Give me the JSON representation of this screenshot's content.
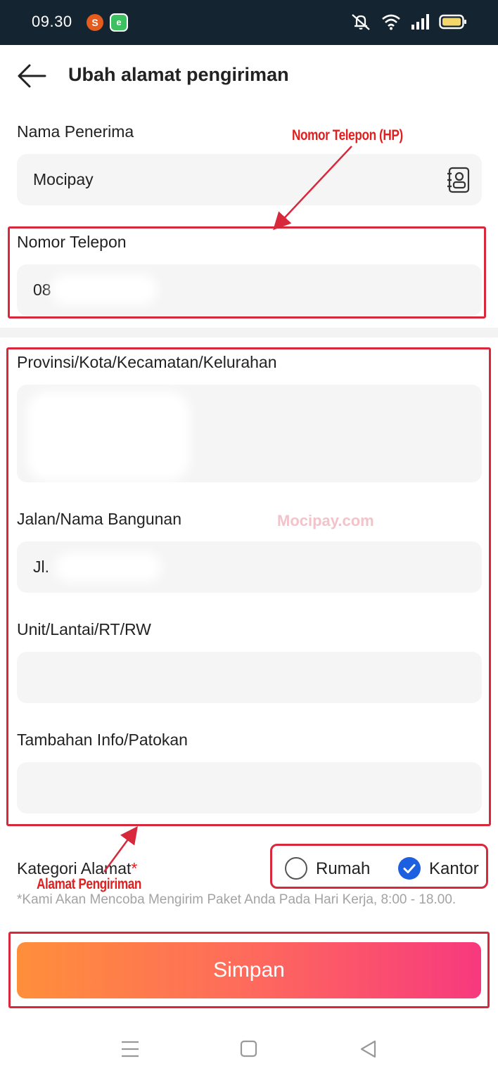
{
  "status_bar": {
    "time": "09.30",
    "app_icon_1": "S",
    "app_icon_2": "e"
  },
  "header": {
    "title": "Ubah alamat pengiriman"
  },
  "form": {
    "nama_label": "Nama Penerima",
    "nama_value": "Mocipay",
    "phone_label": "Nomor Telepon",
    "phone_value": "08",
    "region_label": "Provinsi/Kota/Kecamatan/Kelurahan",
    "region_value": "",
    "street_label": "Jalan/Nama Bangunan",
    "street_value": "Jl. ",
    "unit_label": "Unit/Lantai/RT/RW",
    "unit_value": "",
    "extra_label": "Tambahan Info/Patokan",
    "extra_value": ""
  },
  "category": {
    "label": "Kategori Alamat",
    "required_mark": "*",
    "options": [
      {
        "label": "Rumah",
        "selected": false
      },
      {
        "label": "Kantor",
        "selected": true
      }
    ],
    "note": "*Kami Akan Mencoba Mengirim Paket Anda Pada Hari Kerja, 8:00 - 18.00."
  },
  "save_button": "Simpan",
  "annotations": {
    "phone_note": "Nomor Telepon (HP)",
    "address_note": "Alamat Pengiriman",
    "watermark": "Mocipay.com",
    "color": "#d8283c"
  },
  "colors": {
    "status_bar_bg": "#142431",
    "field_bg": "#f5f5f5",
    "radio_selected": "#1c5fe0",
    "button_gradient_start": "#ff8f3b",
    "button_gradient_end": "#f7397e"
  },
  "icons": [
    "back-arrow-icon",
    "contact-book-icon",
    "mute-icon",
    "wifi-icon",
    "signal-icon",
    "battery-icon",
    "menu-icon",
    "home-icon",
    "back-triangle-icon"
  ]
}
